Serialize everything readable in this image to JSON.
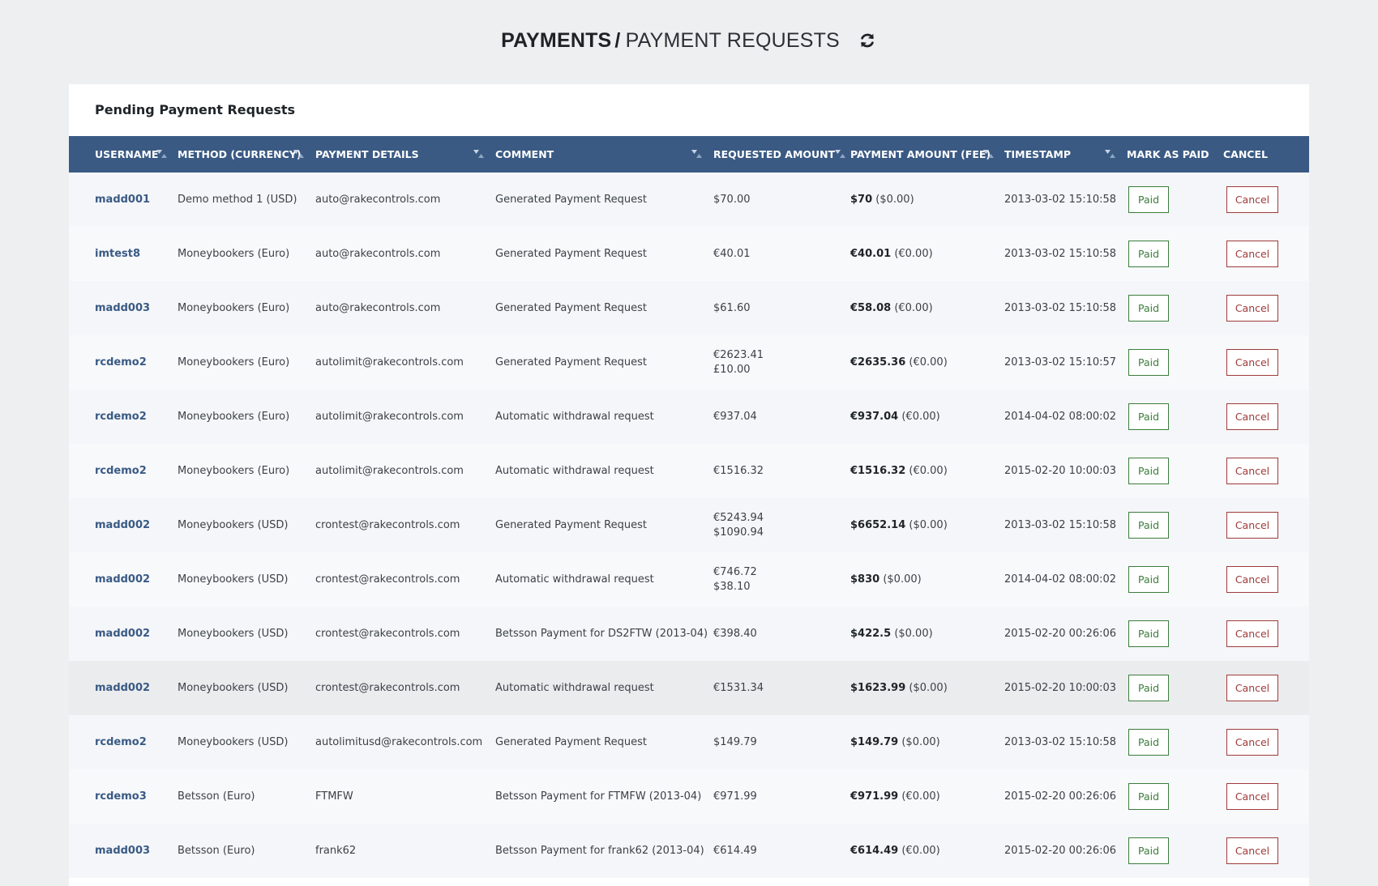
{
  "header": {
    "title_strong": "PAYMENTS",
    "separator": "/",
    "title_light": "PAYMENT REQUESTS",
    "refresh_icon": "refresh-icon"
  },
  "card": {
    "title": "Pending Payment Requests"
  },
  "columns": [
    "USERNAME",
    "METHOD (CURRENCY)",
    "PAYMENT DETAILS",
    "COMMENT",
    "REQUESTED AMOUNT",
    "PAYMENT AMOUNT (FEE)",
    "TIMESTAMP",
    "MARK AS PAID",
    "CANCEL"
  ],
  "paid_label": "Paid",
  "cancel_label": "Cancel",
  "colors": {
    "header_bg": "#3a5a84",
    "paid": "#3b7d3b",
    "cancel": "#a03a3a",
    "username": "#3a5a84"
  },
  "rows": [
    {
      "username": "madd001",
      "method": "Demo method 1 (USD)",
      "details": "auto@rakecontrols.com",
      "comment": "Generated Payment Request",
      "requested": [
        "$70.00"
      ],
      "payment": "$70",
      "fee": "($0.00)",
      "timestamp": "2013-03-02 15:10:58"
    },
    {
      "username": "imtest8",
      "method": "Moneybookers (Euro)",
      "details": "auto@rakecontrols.com",
      "comment": "Generated Payment Request",
      "requested": [
        "€40.01"
      ],
      "payment": "€40.01",
      "fee": "(€0.00)",
      "timestamp": "2013-03-02 15:10:58"
    },
    {
      "username": "madd003",
      "method": "Moneybookers (Euro)",
      "details": "auto@rakecontrols.com",
      "comment": "Generated Payment Request",
      "requested": [
        "$61.60"
      ],
      "payment": "€58.08",
      "fee": "(€0.00)",
      "timestamp": "2013-03-02 15:10:58"
    },
    {
      "username": "rcdemo2",
      "method": "Moneybookers (Euro)",
      "details": "autolimit@rakecontrols.com",
      "comment": "Generated Payment Request",
      "requested": [
        "€2623.41",
        "£10.00"
      ],
      "payment": "€2635.36",
      "fee": "(€0.00)",
      "timestamp": "2013-03-02 15:10:57"
    },
    {
      "username": "rcdemo2",
      "method": "Moneybookers (Euro)",
      "details": "autolimit@rakecontrols.com",
      "comment": "Automatic withdrawal request",
      "requested": [
        "€937.04"
      ],
      "payment": "€937.04",
      "fee": "(€0.00)",
      "timestamp": "2014-04-02 08:00:02"
    },
    {
      "username": "rcdemo2",
      "method": "Moneybookers (Euro)",
      "details": "autolimit@rakecontrols.com",
      "comment": "Automatic withdrawal request",
      "requested": [
        "€1516.32"
      ],
      "payment": "€1516.32",
      "fee": "(€0.00)",
      "timestamp": "2015-02-20 10:00:03"
    },
    {
      "username": "madd002",
      "method": "Moneybookers (USD)",
      "details": "crontest@rakecontrols.com",
      "comment": "Generated Payment Request",
      "requested": [
        "€5243.94",
        "$1090.94"
      ],
      "payment": "$6652.14",
      "fee": "($0.00)",
      "timestamp": "2013-03-02 15:10:58"
    },
    {
      "username": "madd002",
      "method": "Moneybookers (USD)",
      "details": "crontest@rakecontrols.com",
      "comment": "Automatic withdrawal request",
      "requested": [
        "€746.72",
        "$38.10"
      ],
      "payment": "$830",
      "fee": "($0.00)",
      "timestamp": "2014-04-02 08:00:02"
    },
    {
      "username": "madd002",
      "method": "Moneybookers (USD)",
      "details": "crontest@rakecontrols.com",
      "comment": "Betsson Payment for DS2FTW (2013-04)",
      "requested": [
        "€398.40"
      ],
      "payment": "$422.5",
      "fee": "($0.00)",
      "timestamp": "2015-02-20 00:26:06"
    },
    {
      "username": "madd002",
      "method": "Moneybookers (USD)",
      "details": "crontest@rakecontrols.com",
      "comment": "Automatic withdrawal request",
      "requested": [
        "€1531.34"
      ],
      "payment": "$1623.99",
      "fee": "($0.00)",
      "timestamp": "2015-02-20 10:00:03"
    },
    {
      "username": "rcdemo2",
      "method": "Moneybookers (USD)",
      "details": "autolimitusd@rakecontrols.com",
      "comment": "Generated Payment Request",
      "requested": [
        "$149.79"
      ],
      "payment": "$149.79",
      "fee": "($0.00)",
      "timestamp": "2013-03-02 15:10:58"
    },
    {
      "username": "rcdemo3",
      "method": "Betsson (Euro)",
      "details": "FTMFW",
      "comment": "Betsson Payment for FTMFW (2013-04)",
      "requested": [
        "€971.99"
      ],
      "payment": "€971.99",
      "fee": "(€0.00)",
      "timestamp": "2015-02-20 00:26:06"
    },
    {
      "username": "madd003",
      "method": "Betsson (Euro)",
      "details": "frank62",
      "comment": "Betsson Payment for frank62 (2013-04)",
      "requested": [
        "€614.49"
      ],
      "payment": "€614.49",
      "fee": "(€0.00)",
      "timestamp": "2015-02-20 00:26:06"
    }
  ]
}
